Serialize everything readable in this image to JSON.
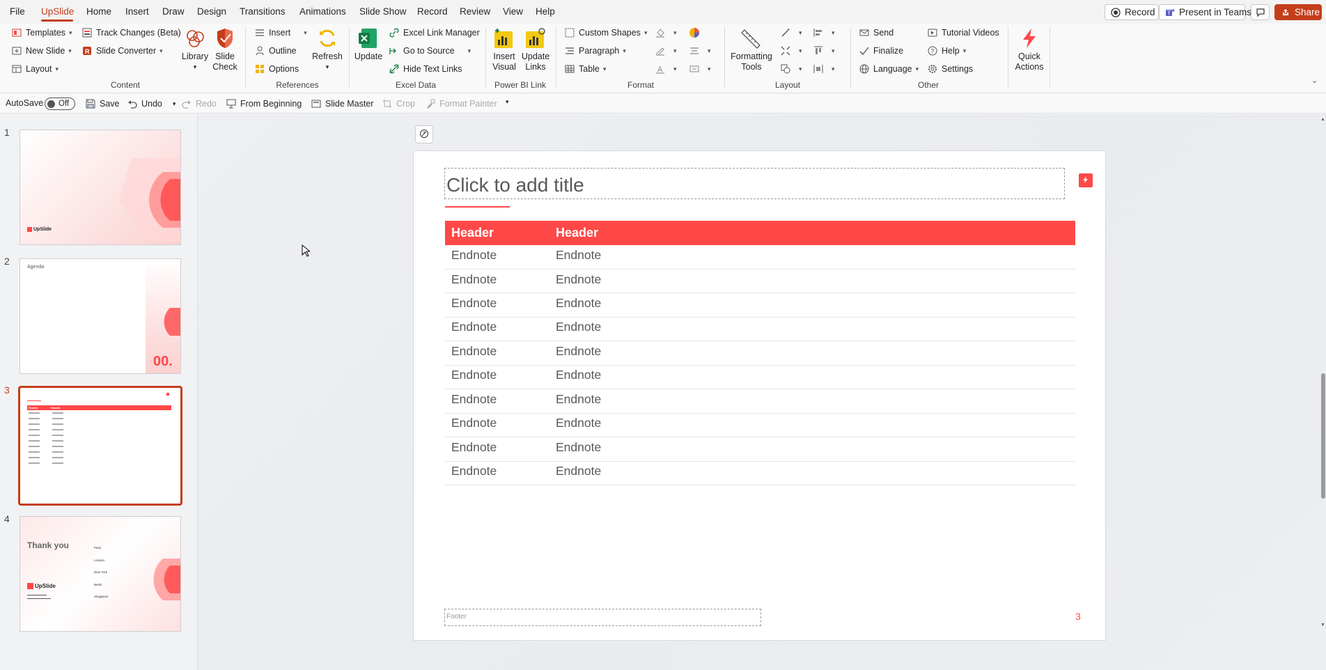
{
  "menu": {
    "tabs": [
      "File",
      "UpSlide",
      "Home",
      "Insert",
      "Draw",
      "Design",
      "Transitions",
      "Animations",
      "Slide Show",
      "Record",
      "Review",
      "View",
      "Help"
    ],
    "active_tab": "UpSlide",
    "record_label": "Record",
    "teams_label": "Present in Teams",
    "share_label": "Share"
  },
  "ribbon": {
    "content": {
      "templates": "Templates",
      "new_slide": "New Slide",
      "layout": "Layout",
      "track_changes": "Track Changes (Beta)",
      "slide_converter": "Slide Converter",
      "library": "Library",
      "slide_check_1": "Slide",
      "slide_check_2": "Check",
      "group": "Content"
    },
    "references": {
      "insert": "Insert",
      "outline": "Outline",
      "options": "Options",
      "refresh": "Refresh",
      "group": "References"
    },
    "excel": {
      "update": "Update",
      "excel_link_manager": "Excel Link Manager",
      "go_to_source": "Go to Source",
      "hide_text_links": "Hide Text Links",
      "group": "Excel Data"
    },
    "powerbi": {
      "insert_visual_1": "Insert",
      "insert_visual_2": "Visual",
      "update_links_1": "Update",
      "update_links_2": "Links",
      "group": "Power BI Link"
    },
    "format": {
      "custom_shapes": "Custom Shapes",
      "paragraph": "Paragraph",
      "table": "Table",
      "group": "Format"
    },
    "layout": {
      "formatting_tools_1": "Formatting",
      "formatting_tools_2": "Tools",
      "group": "Layout"
    },
    "other": {
      "send": "Send",
      "finalize": "Finalize",
      "language": "Language",
      "tutorial_videos": "Tutorial Videos",
      "help": "Help",
      "settings": "Settings",
      "group": "Other"
    },
    "quick_actions_1": "Quick",
    "quick_actions_2": "Actions"
  },
  "qat": {
    "autosave": "AutoSave",
    "autosave_state": "Off",
    "save": "Save",
    "undo": "Undo",
    "redo": "Redo",
    "from_beginning": "From Beginning",
    "slide_master": "Slide Master",
    "crop": "Crop",
    "format_painter": "Format Painter"
  },
  "thumbnails": {
    "numbers": [
      "1",
      "2",
      "3",
      "4"
    ],
    "slide1_logo": "UpSlide",
    "slide2_title": "Agenda",
    "slide2_num": "00.",
    "slide3_headers": [
      "Header",
      "Header"
    ],
    "slide4_title": "Thank you",
    "slide4_logo": "UpSlide",
    "slide4_cities": [
      "Paris",
      "London",
      "New York",
      "Berlin",
      "Singapore"
    ]
  },
  "slide": {
    "title_placeholder": "Click to add title",
    "table": {
      "headers": [
        "Header",
        "Header"
      ],
      "rows": [
        [
          "Endnote",
          "Endnote"
        ],
        [
          "Endnote",
          "Endnote"
        ],
        [
          "Endnote",
          "Endnote"
        ],
        [
          "Endnote",
          "Endnote"
        ],
        [
          "Endnote",
          "Endnote"
        ],
        [
          "Endnote",
          "Endnote"
        ],
        [
          "Endnote",
          "Endnote"
        ],
        [
          "Endnote",
          "Endnote"
        ],
        [
          "Endnote",
          "Endnote"
        ],
        [
          "Endnote",
          "Endnote"
        ]
      ]
    },
    "footer_placeholder": "Footer",
    "page_number": "3"
  },
  "colors": {
    "accent": "#c43e1c",
    "brand_red": "#ff4848"
  }
}
